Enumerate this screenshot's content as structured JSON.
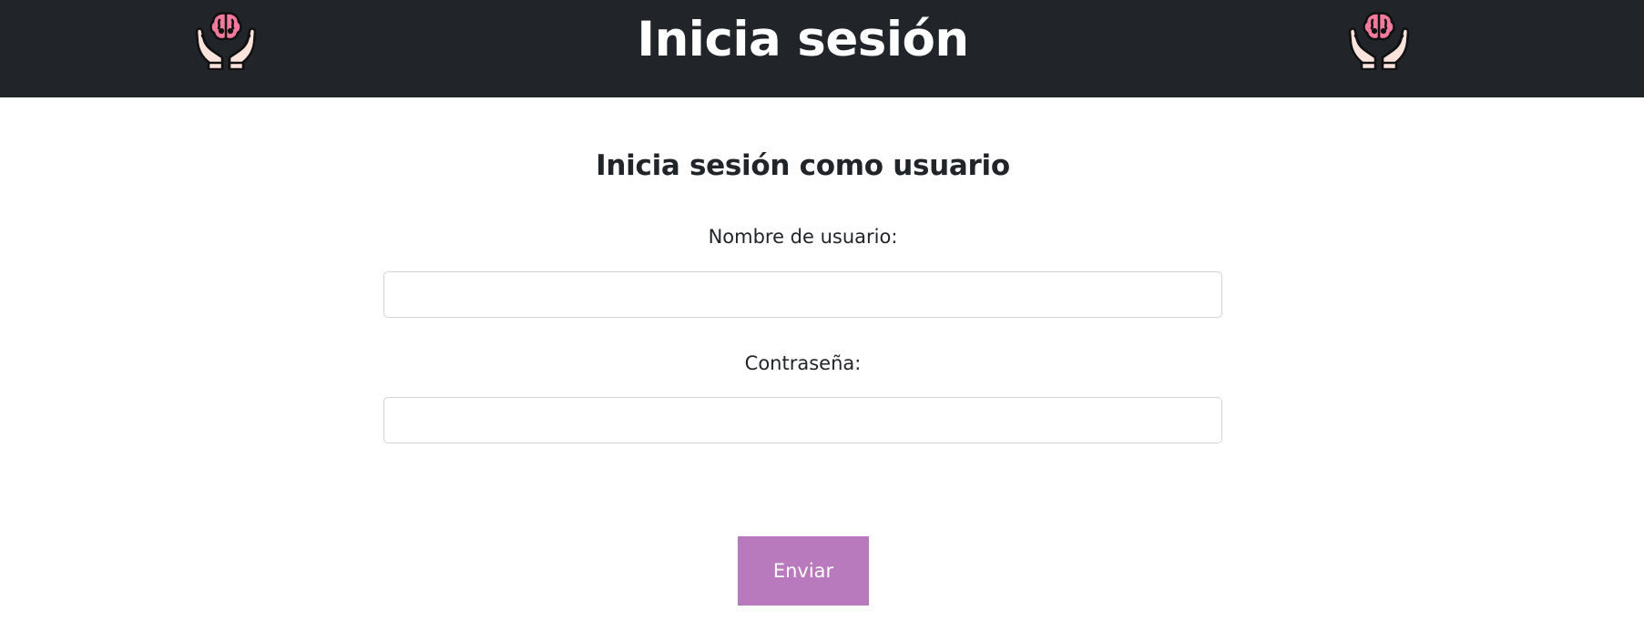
{
  "header": {
    "title": "Inicia sesión",
    "logo_icon": "hands-holding-brain-icon",
    "background_color": "#212529"
  },
  "form": {
    "title": "Inicia sesión como usuario",
    "username_label": "Nombre de usuario:",
    "username_value": "",
    "password_label": "Contraseña:",
    "password_value": "",
    "submit_label": "Enviar",
    "submit_color": "#b87abd"
  }
}
